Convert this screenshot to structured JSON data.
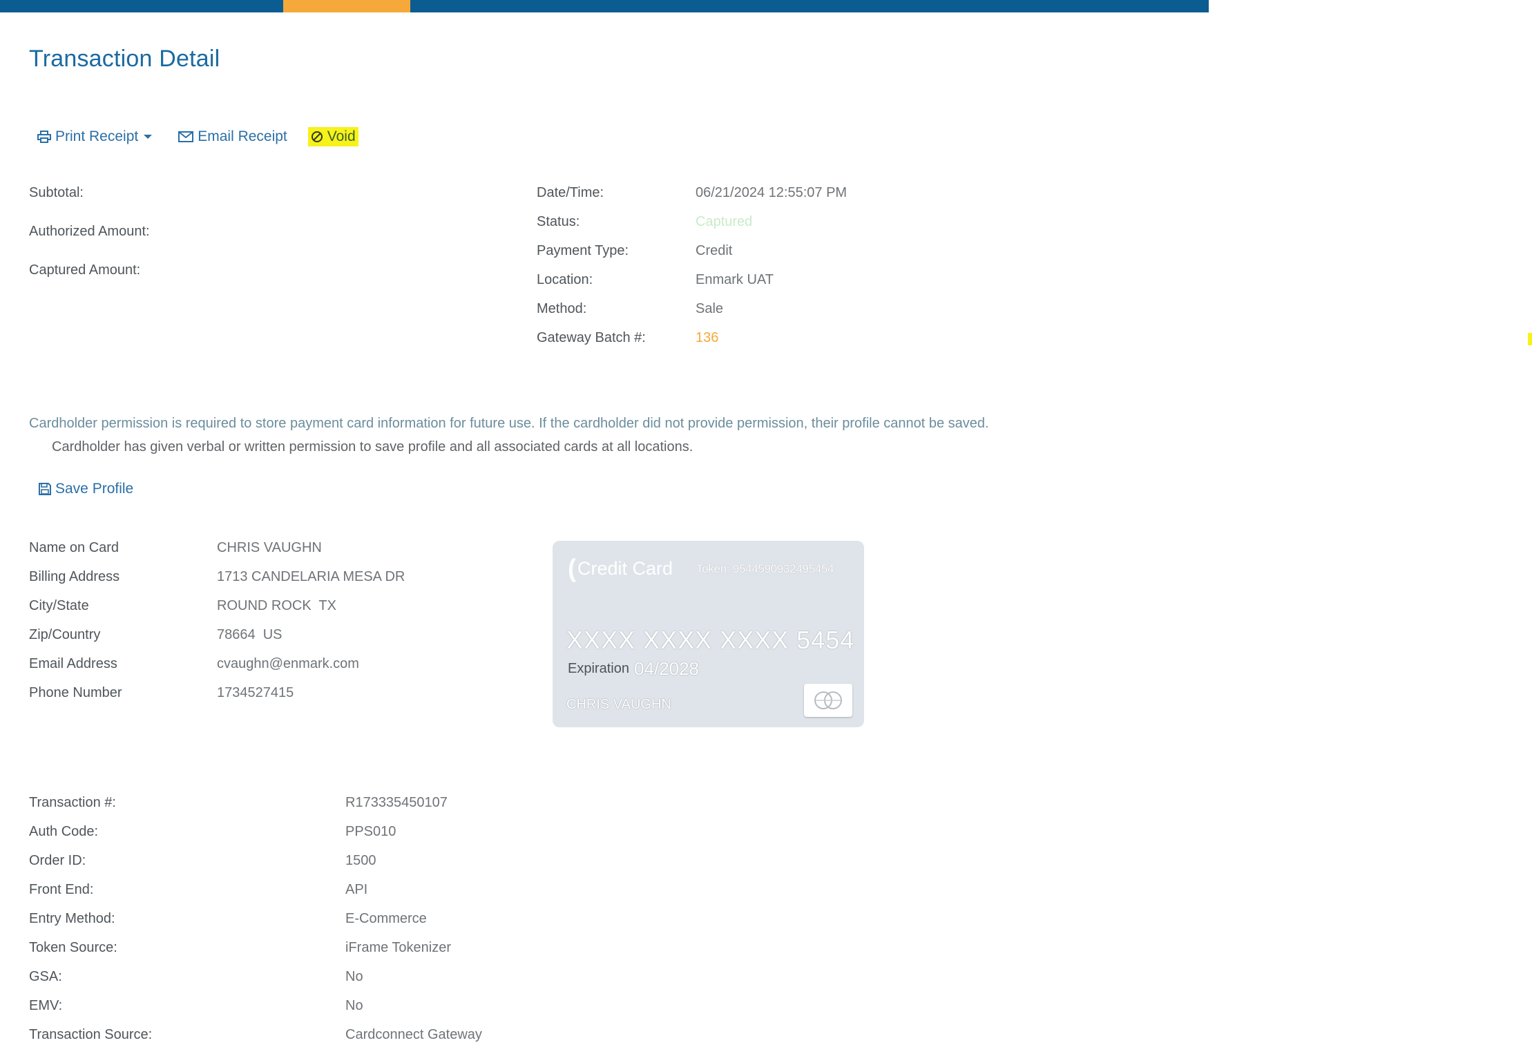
{
  "header": {
    "title": "Transaction Detail",
    "colors": {
      "bar": "#0a5c91",
      "accent": "#f5a93a"
    }
  },
  "actions": {
    "print_label": "Print Receipt",
    "email_label": "Email Receipt",
    "void_label": "Void"
  },
  "amounts": {
    "subtotal_label": "Subtotal:",
    "authorized_label": "Authorized Amount:",
    "captured_label": "Captured Amount:"
  },
  "summary": [
    {
      "label": "Date/Time:",
      "value": "06/21/2024 12:55:07 PM"
    },
    {
      "label": "Status:",
      "value": "Captured"
    },
    {
      "label": "Payment Type:",
      "value": "Credit"
    },
    {
      "label": "Location:",
      "value": "Enmark UAT"
    },
    {
      "label": "Method:",
      "value": "Sale"
    },
    {
      "label": "Gateway Batch #:",
      "value": "136"
    }
  ],
  "permission": {
    "notice": "Cardholder permission is required to store payment card information for future use. If the cardholder did not provide permission, their profile cannot be saved.",
    "checkbox_label": "Cardholder has given verbal or written permission to save profile and all associated cards at all locations.",
    "save_profile_label": "Save Profile"
  },
  "cardholder": [
    {
      "label": "Name on Card",
      "value": "CHRIS VAUGHN"
    },
    {
      "label": "Billing Address",
      "value": "1713 CANDELARIA MESA DR"
    },
    {
      "label": "City/State",
      "value": "ROUND ROCK  TX"
    },
    {
      "label": "Zip/Country",
      "value": "78664  US"
    },
    {
      "label": "Email Address",
      "value": "cvaughn@enmark.com"
    },
    {
      "label": "Phone Number",
      "value": "1734527415"
    }
  ],
  "card": {
    "brand": "Credit Card",
    "token": "Token: 9544590932495454",
    "number": "XXXX XXXX XXXX 5454",
    "expiration_label": "Expiration",
    "expiration": "04/2028",
    "holder": "CHRIS VAUGHN",
    "network_icon": "mastercard-icon"
  },
  "transaction": [
    {
      "label": "Transaction #:",
      "value": "R173335450107"
    },
    {
      "label": "Auth Code:",
      "value": "PPS010"
    },
    {
      "label": "Order ID:",
      "value": "1500"
    },
    {
      "label": "Front End:",
      "value": "API"
    },
    {
      "label": "Entry Method:",
      "value": "E-Commerce"
    },
    {
      "label": "Token Source:",
      "value": "iFrame Tokenizer"
    },
    {
      "label": "GSA:",
      "value": "No"
    },
    {
      "label": "EMV:",
      "value": "No"
    },
    {
      "label": "Transaction Source:",
      "value": "Cardconnect Gateway"
    }
  ]
}
